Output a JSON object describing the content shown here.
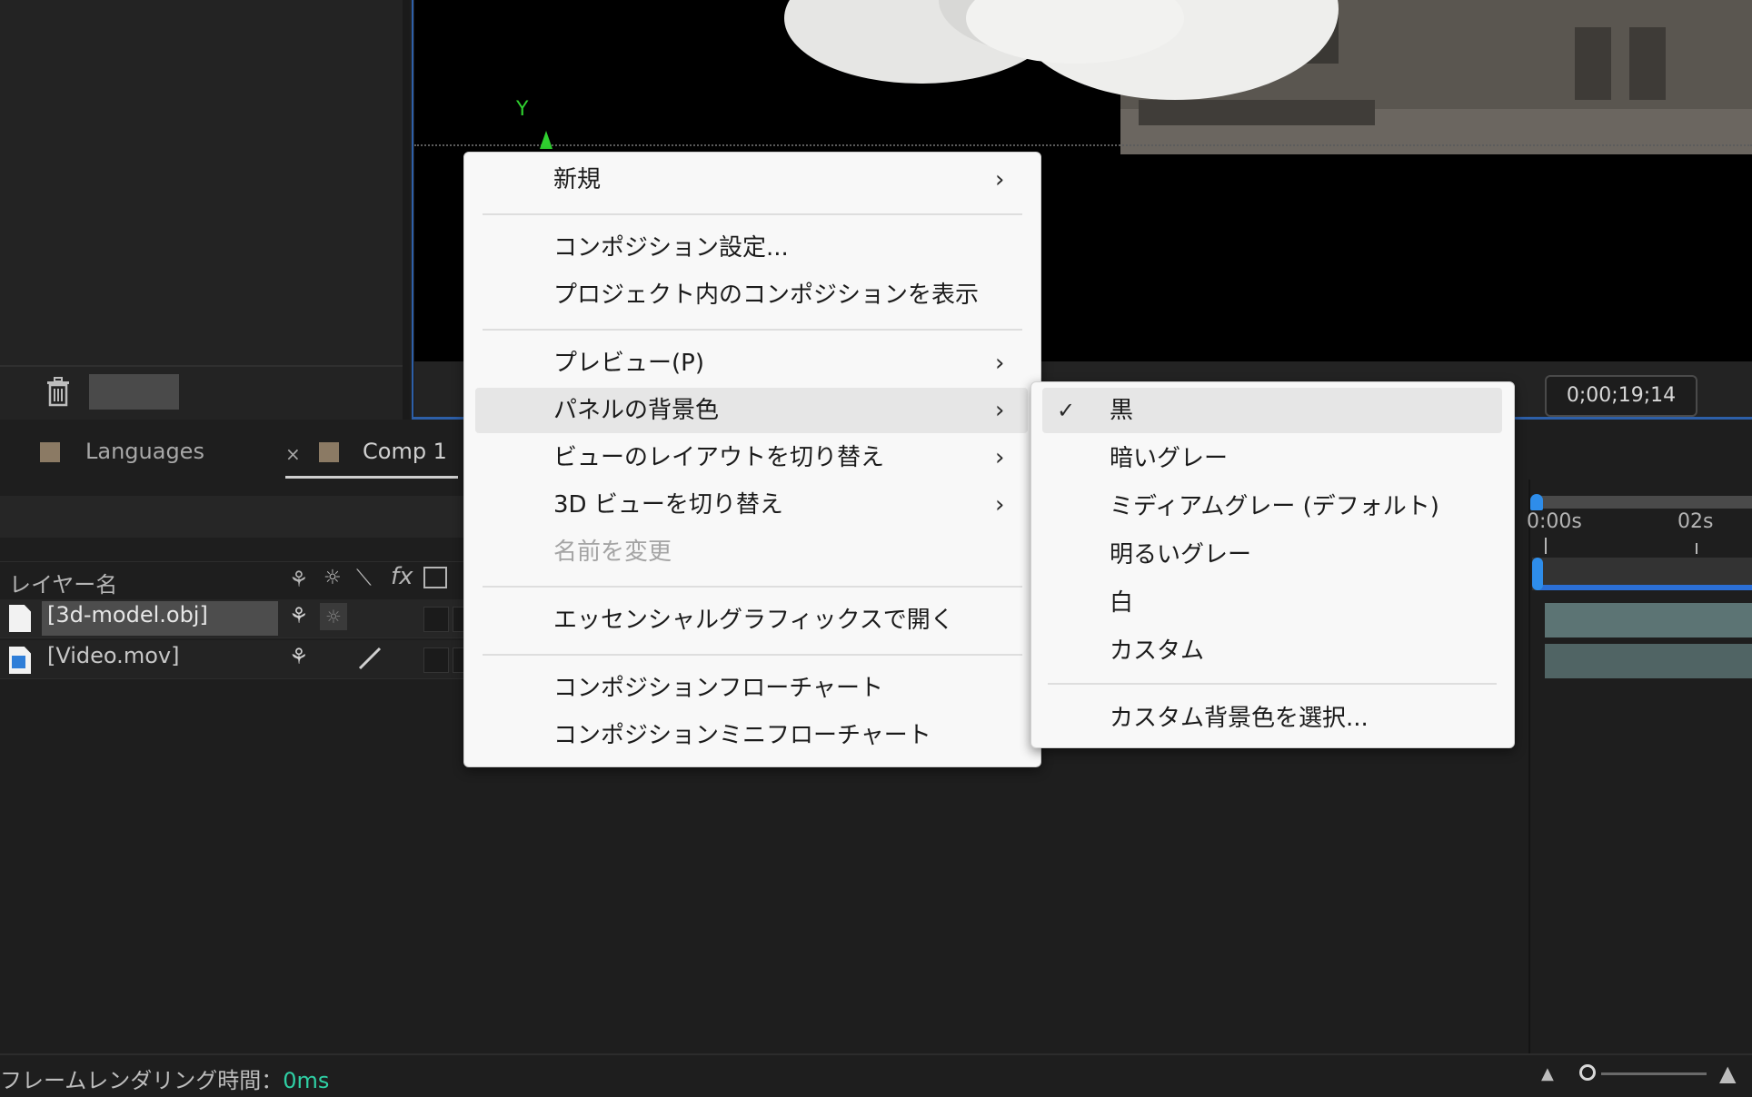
{
  "viewer": {
    "axis_label": "Y",
    "timecode": "0;00;19;14"
  },
  "timeline": {
    "tabs": [
      {
        "label": "Languages"
      },
      {
        "label": "Comp 1"
      }
    ],
    "tab_close": "×",
    "layer_name_header": "レイヤー名",
    "column_icons": {
      "shy": "⚘",
      "collapse": "☼",
      "quality": "⟍",
      "fx": "fx"
    },
    "layers": [
      {
        "name": "[3d-model.obj]"
      },
      {
        "name": "[Video.mov]"
      }
    ],
    "ruler": {
      "start": "0:00s",
      "mark": "02s"
    }
  },
  "status": {
    "render_time_label": "フレームレンダリング時間：",
    "render_time_value": "0ms"
  },
  "context_menu": {
    "items": [
      {
        "label": "新規",
        "submenu": true
      },
      {
        "label": "コンポジション設定..."
      },
      {
        "label": "プロジェクト内のコンポジションを表示"
      },
      {
        "label": "プレビュー(P)",
        "submenu": true
      },
      {
        "label": "パネルの背景色",
        "submenu": true,
        "highlighted": true
      },
      {
        "label": "ビューのレイアウトを切り替え",
        "submenu": true
      },
      {
        "label": "3D ビューを切り替え",
        "submenu": true
      },
      {
        "label": "名前を変更",
        "disabled": true
      },
      {
        "label": "エッセンシャルグラフィックスで開く"
      },
      {
        "label": "コンポジションフローチャート"
      },
      {
        "label": "コンポジションミニフローチャート"
      }
    ],
    "arrow": "›"
  },
  "submenu_background_color": {
    "check": "✓",
    "items": [
      {
        "label": "黒",
        "checked": true,
        "highlighted": true
      },
      {
        "label": "暗いグレー"
      },
      {
        "label": "ミディアムグレー (デフォルト)"
      },
      {
        "label": "明るいグレー"
      },
      {
        "label": "白"
      },
      {
        "label": "カスタム"
      },
      {
        "label": "カスタム背景色を選択..."
      }
    ]
  },
  "icons": {
    "trash": "trash-icon",
    "file": "file-icon",
    "zoom_out": "mountain-small-icon",
    "zoom_in": "mountain-large-icon"
  },
  "colors": {
    "accent_blue": "#2d5fa8",
    "label_swatch": "#8b7a64",
    "render_value": "#2fd0a5"
  }
}
